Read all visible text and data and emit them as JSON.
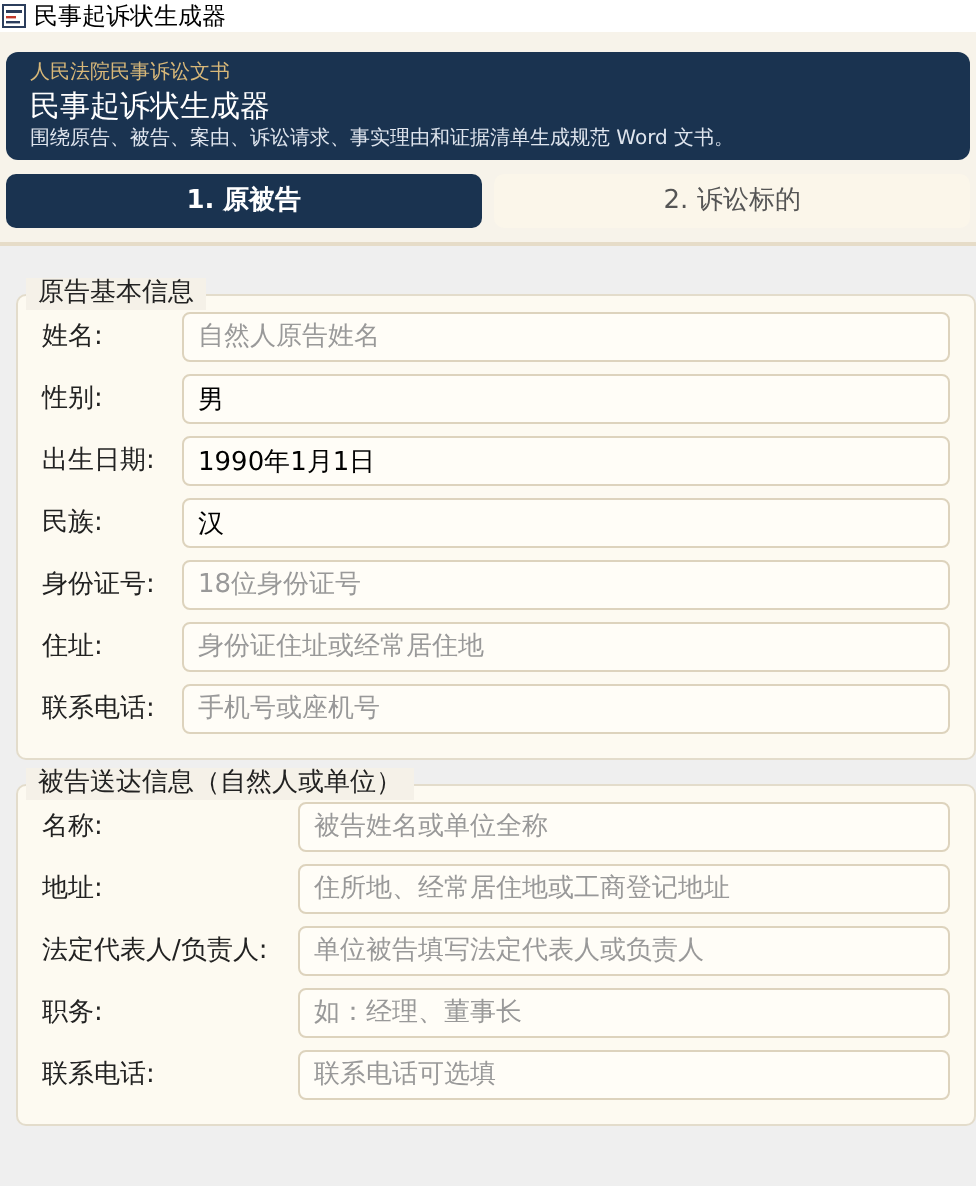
{
  "window": {
    "title": "民事起诉状生成器"
  },
  "header": {
    "eyebrow": "人民法院民事诉讼文书",
    "title": "民事起诉状生成器",
    "subtitle": "围绕原告、被告、案由、诉讼请求、事实理由和证据清单生成规范 Word 文书。"
  },
  "tabs": [
    {
      "label": "1. 原被告",
      "selected": true
    },
    {
      "label": "2. 诉讼标的",
      "selected": false
    }
  ],
  "groups": [
    {
      "title": "原告基本信息",
      "fields": [
        {
          "label": "姓名:",
          "placeholder": "自然人原告姓名"
        },
        {
          "label": "性别:",
          "value": "男"
        },
        {
          "label": "出生日期:",
          "value": "1990年1月1日"
        },
        {
          "label": "民族:",
          "value": "汉"
        },
        {
          "label": "身份证号:",
          "placeholder": "18位身份证号"
        },
        {
          "label": "住址:",
          "placeholder": "身份证住址或经常居住地"
        },
        {
          "label": "联系电话:",
          "placeholder": "手机号或座机号"
        }
      ]
    },
    {
      "title": "被告送达信息（自然人或单位）",
      "fields": [
        {
          "label": "名称:",
          "placeholder": "被告姓名或单位全称"
        },
        {
          "label": "地址:",
          "placeholder": "住所地、经常居住地或工商登记地址"
        },
        {
          "label": "法定代表人/负责人:",
          "placeholder": "单位被告填写法定代表人或负责人"
        },
        {
          "label": "职务:",
          "placeholder": "如：经理、董事长"
        },
        {
          "label": "联系电话:",
          "placeholder": "联系电话可选填"
        }
      ]
    }
  ]
}
